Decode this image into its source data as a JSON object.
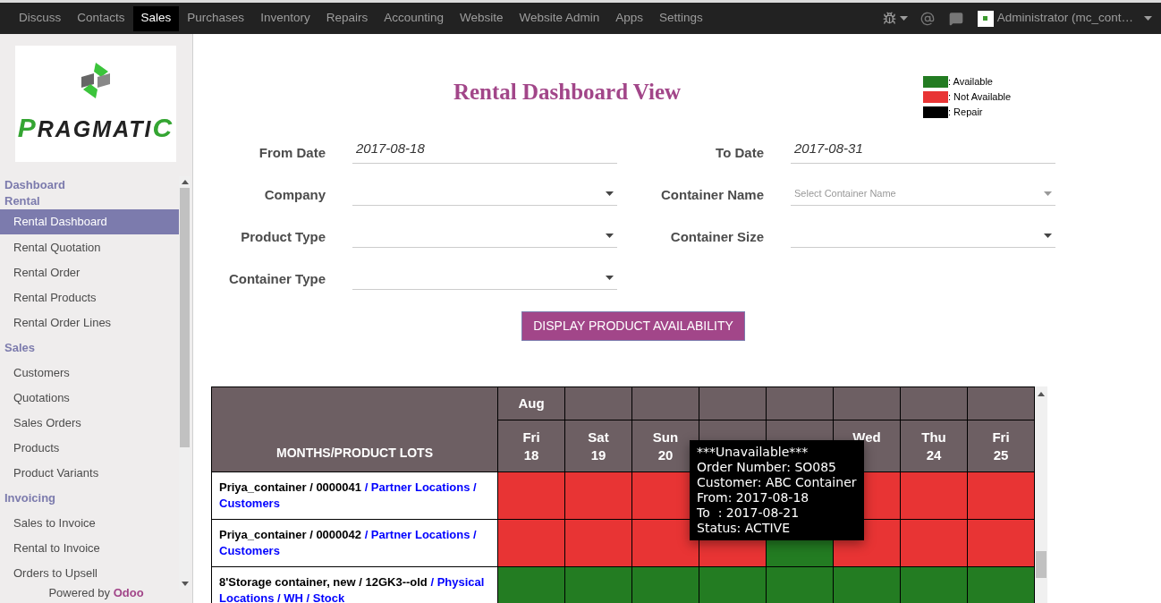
{
  "top_menu": [
    {
      "label": "Discuss",
      "selected": false
    },
    {
      "label": "Contacts",
      "selected": false
    },
    {
      "label": "Sales",
      "selected": true
    },
    {
      "label": "Purchases",
      "selected": false
    },
    {
      "label": "Inventory",
      "selected": false
    },
    {
      "label": "Repairs",
      "selected": false
    },
    {
      "label": "Accounting",
      "selected": false
    },
    {
      "label": "Website",
      "selected": false
    },
    {
      "label": "Website Admin",
      "selected": false
    },
    {
      "label": "Apps",
      "selected": false
    },
    {
      "label": "Settings",
      "selected": false
    }
  ],
  "user": "Administrator (mc_cont…",
  "logo": "PRAGMATIC",
  "sidebar": [
    {
      "title": "Dashboard"
    },
    {
      "title": "Rental",
      "items": [
        {
          "label": "Rental Dashboard",
          "selected": true
        },
        {
          "label": "Rental Quotation",
          "selected": false
        },
        {
          "label": "Rental Order",
          "selected": false
        },
        {
          "label": "Rental Products",
          "selected": false
        },
        {
          "label": "Rental Order Lines",
          "selected": false
        }
      ]
    },
    {
      "title": "Sales",
      "items": [
        {
          "label": "Customers",
          "selected": false
        },
        {
          "label": "Quotations",
          "selected": false
        },
        {
          "label": "Sales Orders",
          "selected": false
        },
        {
          "label": "Products",
          "selected": false
        },
        {
          "label": "Product Variants",
          "selected": false
        }
      ]
    },
    {
      "title": "Invoicing",
      "items": [
        {
          "label": "Sales to Invoice",
          "selected": false
        },
        {
          "label": "Rental to Invoice",
          "selected": false
        },
        {
          "label": "Orders to Upsell",
          "selected": false
        }
      ]
    }
  ],
  "powered_by": {
    "text": "Powered by",
    "link": "Odoo"
  },
  "title": "Rental Dashboard View",
  "legend": [
    {
      "label": ": Available",
      "color": "#237c22"
    },
    {
      "label": ": Not Available",
      "color": "#e83434"
    },
    {
      "label": ": Repair",
      "color": "#000000"
    }
  ],
  "form": [
    [
      {
        "label": "From Date",
        "kind": "date",
        "value": "2017-08-18"
      },
      {
        "label": "To Date",
        "kind": "date",
        "value": "2017-08-31"
      }
    ],
    [
      {
        "label": "Company",
        "kind": "select"
      },
      {
        "label": "Container Name",
        "kind": "select",
        "placeholder": "Select Container Name"
      }
    ],
    [
      {
        "label": "Product Type",
        "kind": "select"
      },
      {
        "label": "Container Size",
        "kind": "select"
      }
    ],
    [
      {
        "label": "Container Type",
        "kind": "select"
      }
    ]
  ],
  "button": "DISPLAY PRODUCT AVAILABILITY",
  "table": {
    "corner": "MONTHS/PRODUCT LOTS",
    "month": "Aug",
    "days_left": [
      {
        "weekday": "Fri",
        "day": "18"
      },
      {
        "weekday": "Sat",
        "day": "19"
      },
      {
        "weekday": "Sun",
        "day": "20"
      }
    ],
    "days_right": [
      {
        "weekday": "Wed"
      },
      {
        "weekday": "Thu",
        "day": "24"
      },
      {
        "weekday": "Fri",
        "day": "25"
      }
    ],
    "rows": [
      {
        "lot": "Priya_container / 0000041",
        "location": "/ Partner Locations / Customers",
        "cells": [
          {
            "color": "#e83434"
          },
          {
            "color": "#e83434"
          },
          {
            "color": "#e83434"
          },
          null,
          null,
          {
            "color": "#e83434"
          },
          {
            "color": "#e83434"
          },
          {
            "color": "#e83434"
          }
        ]
      },
      {
        "lot": "Priya_container / 0000042",
        "location": "/ Partner Locations / Customers",
        "cells": [
          {
            "color": "#e83434"
          },
          {
            "color": "#e83434"
          },
          {
            "color": "#e83434"
          },
          {
            "color": "#e83434"
          },
          {
            "color": "#237c22"
          },
          {
            "color": "#e83434"
          },
          {
            "color": "#e83434"
          },
          {
            "color": "#e83434"
          }
        ]
      },
      {
        "lot": "8'Storage container, new / 12GK3--old",
        "location": "/ Physical Locations / WH / Stock",
        "cells": [
          {
            "color": "#237c22"
          },
          {
            "color": "#237c22"
          },
          {
            "color": "#237c22"
          },
          {
            "color": "#237c22"
          },
          {
            "color": "#237c22"
          },
          {
            "color": "#237c22"
          },
          {
            "color": "#237c22"
          },
          {
            "color": "#237c22"
          }
        ]
      }
    ]
  },
  "tooltip": [
    "***Unavailable***",
    "Order Number: SO085",
    "Customer: ABC Container",
    "From: 2017-08-18",
    "To  : 2017-08-21",
    "Status: ACTIVE"
  ]
}
